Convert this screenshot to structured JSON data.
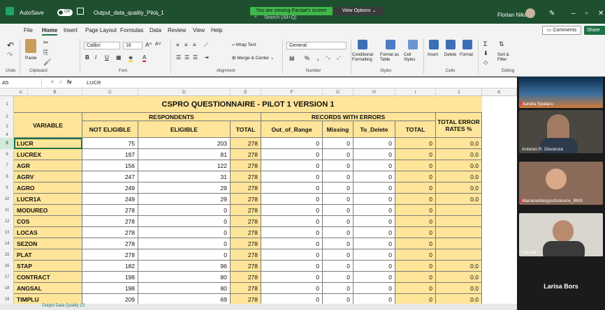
{
  "titlebar": {
    "autosave": "AutoSave",
    "toggle_state": "Off",
    "filename": "Output_data_quality_Pilot_1",
    "sharing_banner": "You are viewing Parstat's screen",
    "view_options": "View Options",
    "search_placeholder": "Search (Alt+Q)",
    "user_name": "Florian Nika"
  },
  "menu": {
    "items": [
      "File",
      "Home",
      "Insert",
      "Page Layout",
      "Formulas",
      "Data",
      "Review",
      "View",
      "Help"
    ],
    "active": "Home",
    "comments": "Comments",
    "share": "Share"
  },
  "ribbon": {
    "groups": [
      "Undo",
      "Clipboard",
      "Font",
      "Alignment",
      "Number",
      "Styles",
      "Cells",
      "Editing"
    ],
    "paste": "Paste",
    "font_name": "Calibri",
    "font_size": "16",
    "wrap_text": "Wrap Text",
    "merge_center": "Merge & Center",
    "number_format": "General",
    "conditional_formatting": "Conditional Formatting",
    "format_as_table": "Format as Table",
    "cell_styles": "Cell Styles",
    "insert": "Insert",
    "delete": "Delete",
    "format": "Format",
    "sort_filter": "Sort & Filter"
  },
  "formula_bar": {
    "name_box": "A5",
    "fx": "fx",
    "value": "LUCR"
  },
  "columns": [
    "A",
    "B",
    "C",
    "D",
    "E",
    "F",
    "G",
    "H",
    "I",
    "J",
    "K"
  ],
  "rows": [
    "1",
    "2",
    "3",
    "4",
    "5",
    "6",
    "7",
    "8",
    "9",
    "10",
    "11",
    "12",
    "13",
    "14",
    "15",
    "16",
    "17",
    "18",
    "19"
  ],
  "selected_row": "5",
  "sheet": {
    "title": "CSPRO QUESTIONNAIRE - PILOT 1  VERSION 1",
    "variable_header": "VARIABLE",
    "respondents_header": "RESPONDENTS",
    "records_header": "RECORDS WITH ERRORS",
    "total_error_header": "TOTAL ERROR RATES %",
    "sub_headers": [
      "NOT ELIGIBLE",
      "ELIGIBLE",
      "TOTAL",
      "Out_of_Range",
      "Missing",
      "To_Delete",
      "TOTAL"
    ],
    "data_rows": [
      {
        "var": "LUCR",
        "not_eligible": "75",
        "eligible": "203",
        "total": "278",
        "oor": "0",
        "missing": "0",
        "to_delete": "0",
        "err_total": "0",
        "rate": "0.0"
      },
      {
        "var": "LUCREX",
        "not_eligible": "197",
        "eligible": "81",
        "total": "278",
        "oor": "0",
        "missing": "0",
        "to_delete": "0",
        "err_total": "0",
        "rate": "0.0"
      },
      {
        "var": "AGR",
        "not_eligible": "156",
        "eligible": "122",
        "total": "278",
        "oor": "0",
        "missing": "0",
        "to_delete": "0",
        "err_total": "0",
        "rate": "0.0"
      },
      {
        "var": "AGRV",
        "not_eligible": "247",
        "eligible": "31",
        "total": "278",
        "oor": "0",
        "missing": "0",
        "to_delete": "0",
        "err_total": "0",
        "rate": "0.0"
      },
      {
        "var": "AGRO",
        "not_eligible": "249",
        "eligible": "29",
        "total": "278",
        "oor": "0",
        "missing": "0",
        "to_delete": "0",
        "err_total": "0",
        "rate": "0.0"
      },
      {
        "var": "LUCR1A",
        "not_eligible": "249",
        "eligible": "29",
        "total": "278",
        "oor": "0",
        "missing": "0",
        "to_delete": "0",
        "err_total": "0",
        "rate": "0.0"
      },
      {
        "var": "MODUREO",
        "not_eligible": "278",
        "eligible": "0",
        "total": "278",
        "oor": "0",
        "missing": "0",
        "to_delete": "0",
        "err_total": "0",
        "rate": ""
      },
      {
        "var": "COS",
        "not_eligible": "278",
        "eligible": "0",
        "total": "278",
        "oor": "0",
        "missing": "0",
        "to_delete": "0",
        "err_total": "0",
        "rate": ""
      },
      {
        "var": "LOCAS",
        "not_eligible": "278",
        "eligible": "0",
        "total": "278",
        "oor": "0",
        "missing": "0",
        "to_delete": "0",
        "err_total": "0",
        "rate": ""
      },
      {
        "var": "SEZON",
        "not_eligible": "278",
        "eligible": "0",
        "total": "278",
        "oor": "0",
        "missing": "0",
        "to_delete": "0",
        "err_total": "0",
        "rate": ""
      },
      {
        "var": "PLAT",
        "not_eligible": "278",
        "eligible": "0",
        "total": "278",
        "oor": "0",
        "missing": "0",
        "to_delete": "0",
        "err_total": "0",
        "rate": ""
      },
      {
        "var": "STAP",
        "not_eligible": "182",
        "eligible": "96",
        "total": "278",
        "oor": "0",
        "missing": "0",
        "to_delete": "0",
        "err_total": "0",
        "rate": "0.0"
      },
      {
        "var": "CONTRACT",
        "not_eligible": "198",
        "eligible": "80",
        "total": "278",
        "oor": "0",
        "missing": "0",
        "to_delete": "0",
        "err_total": "0",
        "rate": "0.0"
      },
      {
        "var": "ANGSAL",
        "not_eligible": "198",
        "eligible": "80",
        "total": "278",
        "oor": "0",
        "missing": "0",
        "to_delete": "0",
        "err_total": "0",
        "rate": "0.0"
      },
      {
        "var": "TIMPLU",
        "not_eligible": "209",
        "eligible": "69",
        "total": "278",
        "oor": "0",
        "missing": "0",
        "to_delete": "0",
        "err_total": "0",
        "rate": "0.0"
      }
    ]
  },
  "sheet_tab": "Output Data Quality L5",
  "participants": [
    {
      "name": "Aurelia Spataru"
    },
    {
      "name": "Antonio R. Discenza"
    },
    {
      "name": "MarianaAlergusSoloviov_BNS"
    },
    {
      "name": "Parstat"
    }
  ],
  "active_speaker": "Larisa Bors",
  "colors": {
    "excel_green": "#1e7145",
    "sheet_yellow": "#fee599",
    "banner_green": "#3fb74a"
  }
}
